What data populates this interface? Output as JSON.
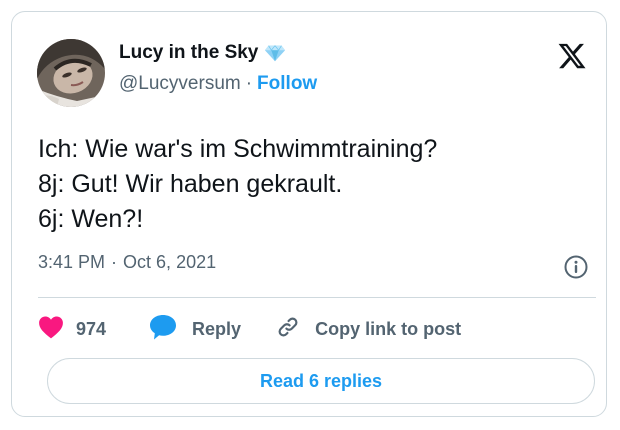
{
  "author": {
    "display_name": "Lucy in the Sky",
    "handle": "@Lucyversum",
    "separator": "·",
    "follow_label": "Follow",
    "verified_icon": "diamond-icon"
  },
  "tweet": {
    "lines": [
      "Ich: Wie war's im Schwimmtraining?",
      "8j: Gut! Wir haben gekrault.",
      "6j: Wen?!"
    ],
    "time": "3:41 PM",
    "separator": "·",
    "date": "Oct 6, 2021"
  },
  "actions": {
    "like_count": "974",
    "reply_label": "Reply",
    "copy_label": "Copy link to post"
  },
  "read_replies_label": "Read 6 replies",
  "colors": {
    "accent": "#1d9bf0",
    "like": "#f91880",
    "secondary_text": "#536471",
    "border": "#cfd9de"
  }
}
